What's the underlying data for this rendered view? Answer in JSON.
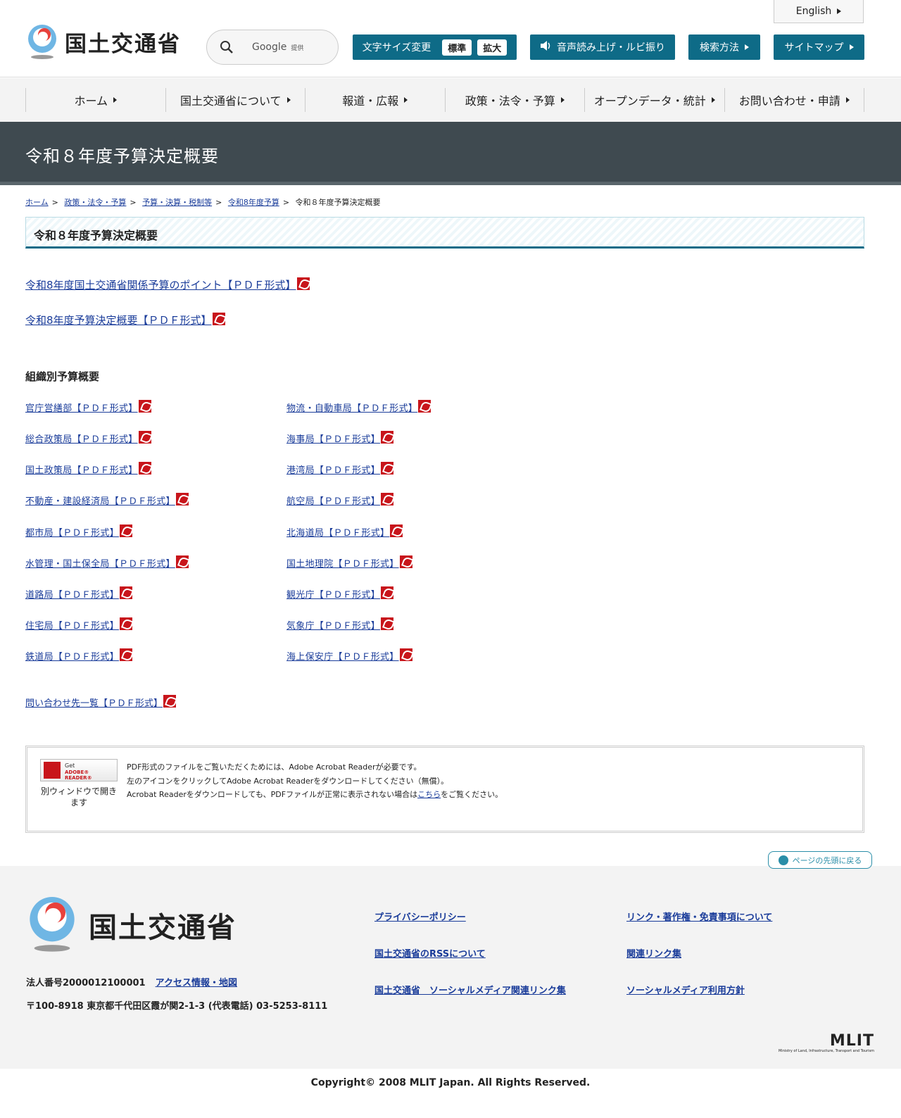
{
  "header": {
    "logo_text": "国土交通省",
    "search_placeholder": "Google",
    "search_provided": "提供",
    "english": "English",
    "font_size_label": "文字サイズ変更",
    "font_standard": "標準",
    "font_large": "拡大",
    "voice": "音声読み上げ・ルビ振り",
    "search_method": "検索方法",
    "sitemap": "サイトマップ"
  },
  "nav": [
    "ホーム",
    "国土交通省について",
    "報道・広報",
    "政策・法令・予算",
    "オープンデータ・統計",
    "お問い合わせ・申請"
  ],
  "page_title": "令和８年度予算決定概要",
  "breadcrumb": [
    "ホーム",
    "政策・法令・予算",
    "予算・決算・税制等",
    "令和8年度予算",
    "令和８年度予算決定概要"
  ],
  "heading": "令和８年度予算決定概要",
  "main_links": [
    "令和8年度国土交通省関係予算のポイント【ＰＤＦ形式】",
    "令和8年度予算決定概要【ＰＤＦ形式】"
  ],
  "org_title": "組織別予算概要",
  "org_left": [
    "官庁営繕部【ＰＤＦ形式】",
    "総合政策局【ＰＤＦ形式】",
    "国土政策局【ＰＤＦ形式】",
    "不動産・建設経済局【ＰＤＦ形式】",
    "都市局【ＰＤＦ形式】",
    "水管理・国土保全局【ＰＤＦ形式】",
    "道路局【ＰＤＦ形式】",
    "住宅局【ＰＤＦ形式】",
    "鉄道局【ＰＤＦ形式】"
  ],
  "org_right": [
    "物流・自動車局【ＰＤＦ形式】",
    "海事局【ＰＤＦ形式】",
    "港湾局【ＰＤＦ形式】",
    "航空局【ＰＤＦ形式】",
    "北海道局【ＰＤＦ形式】",
    "国土地理院【ＰＤＦ形式】",
    "観光庁【ＰＤＦ形式】",
    "気象庁【ＰＤＦ形式】",
    "海上保安庁【ＰＤＦ形式】"
  ],
  "contact_link": "問い合わせ先一覧【ＰＤＦ形式】",
  "adobe": {
    "badge_get": "Get",
    "badge_reader": "ADOBE® READER®",
    "caption": "別ウィンドウで開きます",
    "line1": "PDF形式のファイルをご覧いただくためには、Adobe Acrobat Readerが必要です。",
    "line2": "左のアイコンをクリックしてAdobe Acrobat Readerをダウンロードしてください（無償）。",
    "line3_pre": "Acrobat Readerをダウンロードしても、PDFファイルが正常に表示されない場合は",
    "line3_link": "こちら",
    "line3_post": "をご覧ください。"
  },
  "pagetop": "ページの先頭に戻る",
  "footer": {
    "logo_text": "国土交通省",
    "corp_no": "法人番号2000012100001",
    "access": "アクセス情報・地図",
    "address": "〒100-8918 東京都千代田区霞が関2-1-3 (代表電話) 03-5253-8111",
    "links": [
      "プライバシーポリシー",
      "リンク・著作権・免責事項について",
      "国土交通省のRSSについて",
      "関連リンク集",
      "国土交通省　ソーシャルメディア関連リンク集",
      "ソーシャルメディア利用方針"
    ],
    "mlit": "MLIT",
    "mlit_sub": "Ministry of Land, Infrastructure, Transport and Tourism",
    "copyright": "Copyright© 2008 MLIT Japan. All Rights Reserved."
  },
  "colors": {
    "accent": "#0e6b87",
    "title_band": "#3f4a50",
    "link": "#1a3c9a",
    "pdf": "#c8151b"
  }
}
